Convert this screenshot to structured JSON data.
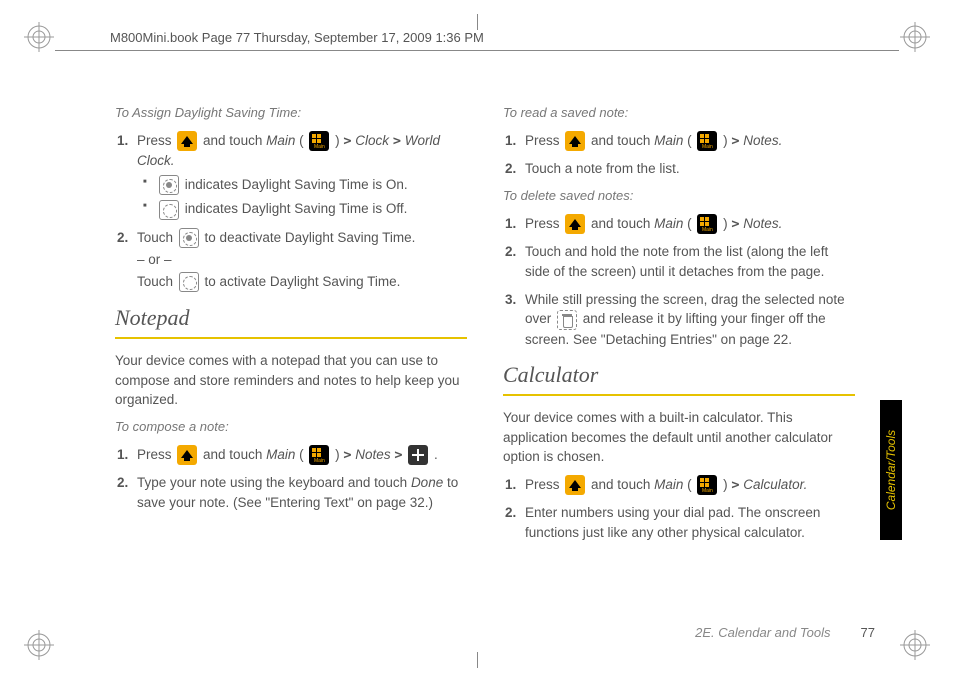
{
  "header": {
    "runner": "M800Mini.book  Page 77  Thursday, September 17, 2009  1:36 PM"
  },
  "sideTab": {
    "label": "Calendar/Tools"
  },
  "footer": {
    "section": "2E. Calendar and Tools",
    "page": "77"
  },
  "left": {
    "dst": {
      "heading": "To Assign Daylight Saving Time:",
      "step1_a": "Press ",
      "step1_b": " and touch ",
      "step1_mainWord": "Main",
      "step1_c": " ( ",
      "step1_d": " ) ",
      "step1_path1": "Clock",
      "step1_path2": "World Clock.",
      "bullet_on": " indicates Daylight Saving Time is On.",
      "bullet_off": " indicates Daylight Saving Time is Off.",
      "step2_a": "Touch ",
      "step2_b": " to deactivate Daylight Saving Time.",
      "orText": "– or –",
      "step2_c": "Touch ",
      "step2_d": " to activate Daylight Saving Time."
    },
    "notepadTitle": "Notepad",
    "notepadIntro": "Your device comes with a notepad that you can use to compose and store reminders and notes to help keep you organized.",
    "compose": {
      "heading": "To compose a note:",
      "s1_a": "Press ",
      "s1_b": " and touch ",
      "s1_main": "Main",
      "s1_c": " ( ",
      "s1_d": " ) ",
      "s1_path": "Notes",
      "s1_end": ".",
      "s2_a": "Type your note using the keyboard and touch ",
      "s2_done": "Done",
      "s2_b": " to save your note. (See \"Entering Text\" on page 32.)"
    }
  },
  "right": {
    "read": {
      "heading": "To read a saved note:",
      "s1_a": "Press ",
      "s1_b": " and touch ",
      "s1_main": "Main",
      "s1_c": " ( ",
      "s1_d": " ) ",
      "s1_path": "Notes.",
      "s2": "Touch a note from the list."
    },
    "delete": {
      "heading": "To delete saved notes:",
      "s1_a": "Press ",
      "s1_b": " and touch ",
      "s1_main": "Main",
      "s1_c": " ( ",
      "s1_d": " ) ",
      "s1_path": "Notes.",
      "s2": "Touch and hold the note from the list (along the left side of the screen) until it detaches from the page.",
      "s3_a": "While still pressing the screen, drag the selected note over ",
      "s3_b": " and release it by lifting your finger off the screen. See \"Detaching Entries\" on page 22."
    },
    "calcTitle": "Calculator",
    "calcIntro": "Your device comes with a built-in calculator. This application becomes the default until another calculator option is chosen.",
    "calcSteps": {
      "s1_a": "Press ",
      "s1_b": " and touch ",
      "s1_main": "Main",
      "s1_c": " ( ",
      "s1_d": " ) ",
      "s1_path": "Calculator.",
      "s2": "Enter numbers using your dial pad. The onscreen functions just like any other physical calculator."
    }
  },
  "gt": ">"
}
